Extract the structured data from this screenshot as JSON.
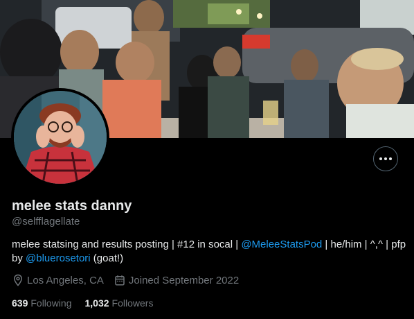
{
  "profile": {
    "display_name": "melee stats danny",
    "handle": "@selfflagellate",
    "bio": {
      "part1": "melee statsing and results posting | #12 in socal | ",
      "mention1": "@MeleeStatsPod",
      "part2": " | he/him | ^,^ | pfp by ",
      "mention2": "@bluerosetori",
      "part3": " (goat!)"
    },
    "location": "Los Angeles, CA",
    "joined": "Joined September 2022",
    "following_count": "639",
    "following_label": "Following",
    "followers_count": "1,032",
    "followers_label": "Followers"
  },
  "icons": {
    "more": "more-horizontal-icon",
    "location": "location-pin-icon",
    "calendar": "calendar-icon"
  },
  "colors": {
    "background": "#000000",
    "text_primary": "#e7e9ea",
    "text_secondary": "#71767b",
    "link": "#1d9bf0",
    "avatar_shirt": "#c8323c"
  }
}
